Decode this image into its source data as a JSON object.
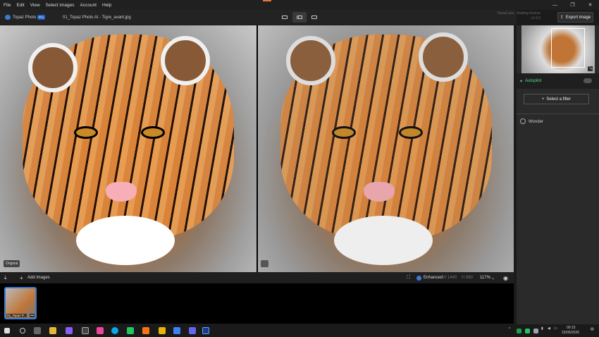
{
  "menu": {
    "items": [
      "File",
      "Edit",
      "View",
      "Select images",
      "Account",
      "Help"
    ]
  },
  "window": {
    "minimize": "—",
    "maximize": "❐",
    "close": "✕"
  },
  "toolbar": {
    "app_name": "Topaz Photo",
    "badge": "Pro",
    "filename": "01_Topaz Photo AI - Tigre_avant.jpg",
    "watermark_line1": "TopazLabs - floating license",
    "watermark_line2": "v1.6.0",
    "export_label": "Export image"
  },
  "canvas": {
    "original_label": "Original"
  },
  "bottombar": {
    "add_images_label": "Add images",
    "enhanced_label": "Enhanced",
    "width_label": "W",
    "width_value": "1440",
    "height_label": "H",
    "height_value": "960",
    "zoom": "117%"
  },
  "filmstrip": {
    "thumb_label": "01_Topaz P...",
    "thumb_more": "•••"
  },
  "sidepanel": {
    "autopilot_label": "Autopilot",
    "select_filter_label": "Select a filter",
    "filter_item": "Wonder"
  },
  "taskbar": {
    "time": "09:15",
    "date": "15/05/2026"
  },
  "colors": {
    "accent": "#3a7bd5",
    "autopilot_green": "#4ade80",
    "export_bg": "#2e2e2e"
  }
}
